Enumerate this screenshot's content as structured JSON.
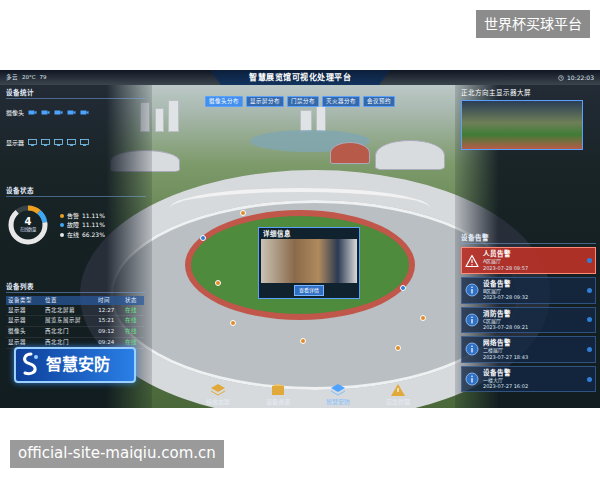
{
  "watermarks": {
    "top": "世界杯买球平台",
    "bottom": "official-site-maiqiu.com.cn"
  },
  "dashboard": {
    "title": "智慧展览馆可视化处理平台",
    "status": [
      "多云",
      "20°C",
      "79"
    ],
    "time": "10:22:03",
    "tabs": [
      {
        "label": "摄像头分布",
        "selected": true
      },
      {
        "label": "显示屏分布",
        "selected": false
      },
      {
        "label": "门禁分布",
        "selected": false
      },
      {
        "label": "灭火器分布",
        "selected": false
      },
      {
        "label": "会议预约",
        "selected": false
      }
    ]
  },
  "left": {
    "stats_title": "设备统计",
    "stat_items": [
      "摄像头",
      "显示器"
    ],
    "status_title": "设备状态",
    "donut": {
      "value": "4",
      "label": "在线数量"
    },
    "legend": [
      {
        "label": "告警",
        "value": "11.11%",
        "level": 0.1111,
        "color": "#f0a020"
      },
      {
        "label": "故障",
        "value": "11.11%",
        "level": 0.1111,
        "color": "#3fa9f5"
      },
      {
        "label": "在线",
        "value": "66.23%",
        "level": 0.6623,
        "color": "#e8e8e8"
      }
    ],
    "list_title": "设备列表",
    "columns": [
      "设备类型",
      "位置",
      "时间",
      "状态"
    ],
    "rows": [
      [
        "显示器",
        "西北北屏幕",
        "12:27",
        "在线"
      ],
      [
        "显示器",
        "展览东展示屏",
        "15:21",
        "在线"
      ],
      [
        "摄像头",
        "西北北门",
        "09:12",
        "在线"
      ],
      [
        "显示器",
        "西北北门",
        "09:24",
        "在线"
      ]
    ]
  },
  "right": {
    "video_title": "正北方向主显示器大屏",
    "alerts_title": "设备告警",
    "alerts": [
      {
        "title": "人员告警",
        "detail": "A区展厅",
        "time": "2023-07-28 09:57",
        "kind": "warning"
      },
      {
        "title": "设备告警",
        "detail": "B区展厅",
        "time": "2023-07-28 09:32",
        "kind": "info"
      },
      {
        "title": "消防告警",
        "detail": "C区展厅",
        "time": "2023-07-28 09:21",
        "kind": "info"
      },
      {
        "title": "网络告警",
        "detail": "二楼展厅",
        "time": "2023-07-27 18:43",
        "kind": "info"
      },
      {
        "title": "设备告警",
        "detail": "一楼大厅",
        "time": "2023-07-27 16:02",
        "kind": "info"
      }
    ]
  },
  "popup": {
    "title": "详细信息",
    "button": "查看详情"
  },
  "nav": [
    {
      "label": "综合态势",
      "selected": false
    },
    {
      "label": "设备资源",
      "selected": false
    },
    {
      "label": "智慧安防",
      "selected": true
    },
    {
      "label": "应急管理",
      "selected": false
    }
  ],
  "badge": "智慧安防"
}
